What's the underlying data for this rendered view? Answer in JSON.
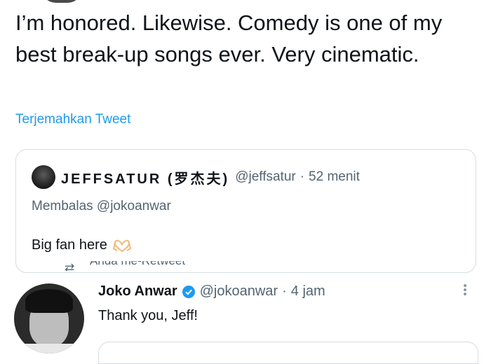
{
  "tweet": {
    "text": "I’m honored. Likewise. Comedy is one of my best break-up songs ever. Very cinematic.",
    "translate_label": "Terjemahkan Tweet"
  },
  "quoted_tweet": {
    "display_name": "JEFFSATUR (罗杰夫)",
    "handle": "@jeffsatur",
    "separator": "·",
    "time": "52 menit",
    "replying_to": "Membalas @jokoanwar",
    "body": "Big fan here",
    "emoji": "heart-hands-icon"
  },
  "retweet_strip": {
    "icon": "retweet-icon",
    "label": "Anda me-Retweet"
  },
  "reply": {
    "display_name": "Joko Anwar",
    "verified": true,
    "handle": "@jokoanwar",
    "separator": "·",
    "time": "4 jam",
    "text": "Thank you, Jeff!"
  },
  "colors": {
    "link": "#1d9bf0",
    "secondary_text": "#536471",
    "primary_text": "#0f1419",
    "border": "#d6dde2",
    "verified": "#1d9bf0"
  }
}
